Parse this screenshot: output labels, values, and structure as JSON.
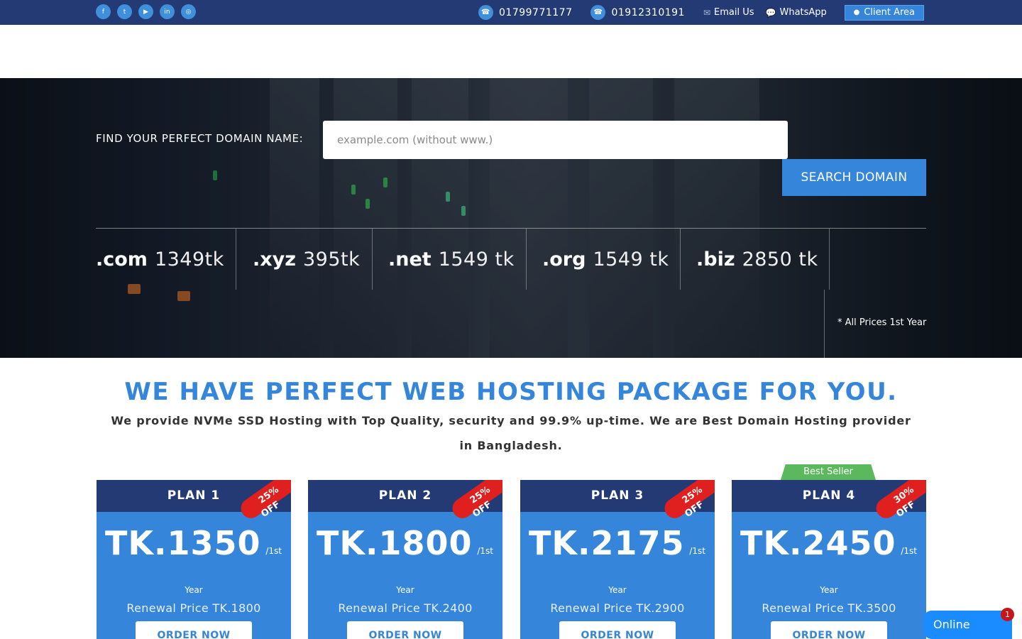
{
  "topbar": {
    "social_icons": [
      "facebook-icon",
      "twitter-icon",
      "youtube-icon",
      "linkedin-icon",
      "instagram-icon"
    ],
    "phones": [
      "01799771177",
      "01912310191"
    ],
    "email_label": "Email Us",
    "whatsapp_label": "WhatsApp",
    "client_label": "Client Area"
  },
  "hero": {
    "find_label": "FIND YOUR PERFECT DOMAIN NAME:",
    "search_placeholder": "example.com (without www.)",
    "search_button": "SEARCH DOMAIN",
    "tlds": [
      {
        "ext": ".com",
        "price": "1349tk"
      },
      {
        "ext": ".xyz",
        "price": "395tk"
      },
      {
        "ext": ".net",
        "price": "1549 tk"
      },
      {
        "ext": ".org",
        "price": "1549 tk"
      },
      {
        "ext": ".biz",
        "price": "2850 tk"
      }
    ],
    "price_note": "* All Prices 1st Year"
  },
  "section": {
    "title": "WE HAVE PERFECT WEB HOSTING PACKAGE FOR YOU.",
    "subtitle": "We provide NVMe SSD Hosting with Top Quality, security and 99.9% up-time. We are Best Domain Hosting provider in Bangladesh."
  },
  "plans": [
    {
      "name": "PLAN 1",
      "discount": "25%",
      "off": "OFF",
      "price": "TK.1350",
      "per": "/1st",
      "year": "Year",
      "renewal": "Renewal Price TK.1800",
      "order": "ORDER NOW"
    },
    {
      "name": "PLAN 2",
      "discount": "25%",
      "off": "OFF",
      "price": "TK.1800",
      "per": "/1st",
      "year": "Year",
      "renewal": "Renewal Price TK.2400",
      "order": "ORDER NOW"
    },
    {
      "name": "PLAN 3",
      "discount": "25%",
      "off": "OFF",
      "price": "TK.2175",
      "per": "/1st",
      "year": "Year",
      "renewal": "Renewal Price TK.2900",
      "order": "ORDER NOW"
    },
    {
      "name": "PLAN 4",
      "discount": "30%",
      "off": "OFF",
      "price": "TK.2450",
      "per": "/1st",
      "year": "Year",
      "renewal": "Renewal Price TK.3500",
      "order": "ORDER NOW"
    }
  ],
  "best_seller": "Best Seller",
  "chat": {
    "label": "Online",
    "badge": "1"
  },
  "colors": {
    "navy": "#233a75",
    "accent": "#3586db",
    "ribbon": "#e0201e",
    "green": "#5cb85c"
  }
}
